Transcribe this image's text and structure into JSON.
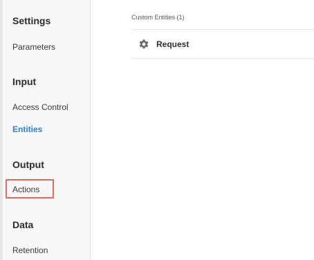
{
  "sidebar": {
    "sections": [
      {
        "title": "Settings",
        "items": [
          "Parameters"
        ]
      },
      {
        "title": "Input",
        "items": [
          "Access Control",
          "Entities"
        ]
      },
      {
        "title": "Output",
        "items": [
          "Actions"
        ]
      },
      {
        "title": "Data",
        "items": [
          "Retention"
        ]
      }
    ],
    "active_item": "Entities",
    "highlighted_item": "Actions"
  },
  "main": {
    "list_header": "Custom Entities (1)",
    "entities": [
      {
        "label": "Request",
        "icon": "gear-icon"
      }
    ]
  },
  "colors": {
    "active_link": "#2a7fd4",
    "highlight_border": "#e06a57",
    "sidebar_bg": "#f7f7f7"
  }
}
